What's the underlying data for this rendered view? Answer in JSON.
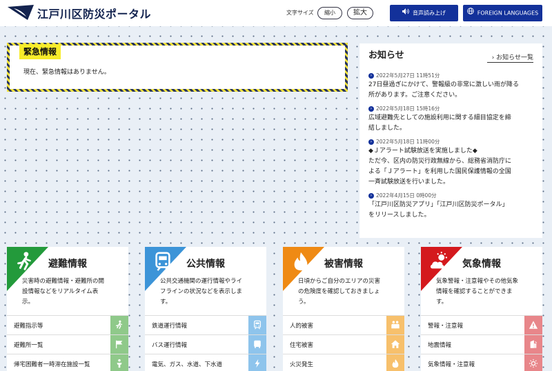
{
  "header": {
    "site_title": "江戸川区防災ポータル",
    "font_size_label": "文字サイズ",
    "shrink_label": "縮小",
    "enlarge_label": "拡大",
    "voice_label": "音声読み上げ",
    "lang_label": "FOREIGN LANGUAGES"
  },
  "emergency": {
    "title": "緊急情報",
    "text": "現在、緊急情報はありません。"
  },
  "notices": {
    "title": "お知らせ",
    "more_label": "お知らせ一覧",
    "items": [
      {
        "date": "2022年5月27日 11時51分",
        "lines": [
          "27日昼過ぎにかけて、警報級の非常に激しい雨が降る",
          "所があります。ご注意ください。"
        ]
      },
      {
        "date": "2022年5月18日 15時16分",
        "lines": [
          "広域避難先としての施設利用に関する細目協定を締",
          "結しました。"
        ]
      },
      {
        "date": "2022年5月18日 11時00分",
        "lines": [
          "◆Ｊアラート試験放送を実施しました◆",
          "ただ今、区内の防災行政無線から、総務省消防庁に",
          "よる「Ｊアラート」を利用した国民保護情報の全国",
          "一斉試験放送を行いました。"
        ]
      },
      {
        "date": "2022年4月15日 0時00分",
        "lines": [
          "「江戸川区防災アプリ」「江戸川区防災ポータル」",
          "をリリースしました。"
        ]
      }
    ]
  },
  "cards": [
    {
      "title": "避難情報",
      "color": "#239a3b",
      "light": "#8fc98a",
      "icon": "evacuation-icon",
      "desc": [
        "災害時の避難情報・避難所の開",
        "設情報などをリアルタイム表",
        "示。"
      ],
      "links": [
        {
          "label": "避難指示等",
          "icon": "running-person-icon"
        },
        {
          "label": "避難所一覧",
          "icon": "flag-icon"
        },
        {
          "label": "帰宅困難者一時滞在施設一覧",
          "icon": "person-icon"
        }
      ]
    },
    {
      "title": "公共情報",
      "color": "#3c94d8",
      "light": "#8ec4ec",
      "icon": "train-icon",
      "desc": [
        "公共交通機関の運行情報やライ",
        "フラインの状況などを表示しま",
        "す。"
      ],
      "links": [
        {
          "label": "鉄道運行情報",
          "icon": "train-icon"
        },
        {
          "label": "バス運行情報",
          "icon": "bus-icon"
        },
        {
          "label": "電気、ガス、水道、下水道",
          "icon": "lightning-icon"
        }
      ]
    },
    {
      "title": "被害情報",
      "color": "#ef8a14",
      "light": "#f7c06c",
      "icon": "fire-icon",
      "desc": [
        "日頃からご自分のエリアの災害",
        "の危険度を確認しておきましょ",
        "う。"
      ],
      "links": [
        {
          "label": "人的被害",
          "icon": "people-icon"
        },
        {
          "label": "住宅被害",
          "icon": "house-icon"
        },
        {
          "label": "火災発生",
          "icon": "fire-icon"
        }
      ]
    },
    {
      "title": "気象情報",
      "color": "#d4191d",
      "light": "#e8868a",
      "icon": "weather-icon",
      "desc": [
        "気象警報・注意報やその他気象",
        "情報を確認することができま",
        "す。"
      ],
      "links": [
        {
          "label": "警報・注意報",
          "icon": "warning-icon"
        },
        {
          "label": "地震情報",
          "icon": "building-icon"
        },
        {
          "label": "気象情報・注意報",
          "icon": "sun-icon"
        }
      ]
    }
  ]
}
